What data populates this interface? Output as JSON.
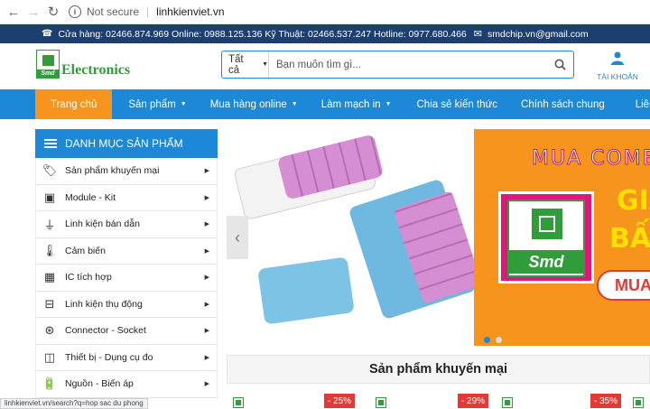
{
  "browser": {
    "security_label": "Not secure",
    "url": "linhkienviet.vn"
  },
  "topbar": {
    "contact_text": "Cửa hàng: 02466.874.969 Online: 0988.125.136 Kỹ Thuật: 02466.537.247 Hotline: 0977.680.466",
    "email": "smdchip.vn@gmail.com"
  },
  "header": {
    "logo_badge": "Smd",
    "logo_text": "Electronics",
    "search_category": "Tất cả",
    "search_placeholder": "Bạn muốn tìm gì...",
    "account_label": "TÀI KHOẢN"
  },
  "mainnav": {
    "items": [
      {
        "label": "Trang chủ",
        "active": true,
        "dropdown": false
      },
      {
        "label": "Sản phẩm",
        "active": false,
        "dropdown": true
      },
      {
        "label": "Mua hàng online",
        "active": false,
        "dropdown": true
      },
      {
        "label": "Làm mạch in",
        "active": false,
        "dropdown": true
      },
      {
        "label": "Chia sẻ kiến thức",
        "active": false,
        "dropdown": false
      },
      {
        "label": "Chính sách chung",
        "active": false,
        "dropdown": false
      },
      {
        "label": "Liên hệ",
        "active": false,
        "dropdown": false
      }
    ]
  },
  "sidebar": {
    "title": "DANH MỤC SẢN PHẨM",
    "items": [
      {
        "label": "Sản phẩm khuyến mại",
        "icon": "tag-icon"
      },
      {
        "label": "Module - Kit",
        "icon": "module-icon"
      },
      {
        "label": "Linh kiện bán dẫn",
        "icon": "transistor-icon"
      },
      {
        "label": "Cảm biến",
        "icon": "thermometer-icon"
      },
      {
        "label": "IC tích hợp",
        "icon": "chip-icon"
      },
      {
        "label": "Linh kiện thụ động",
        "icon": "capacitor-icon"
      },
      {
        "label": "Connector - Socket",
        "icon": "connector-icon"
      },
      {
        "label": "Thiết bị - Dụng cụ đo",
        "icon": "meter-icon"
      },
      {
        "label": "Nguồn - Biến áp",
        "icon": "car-battery-icon"
      }
    ]
  },
  "banner": {
    "headline": "MUA COMBO",
    "line1": "GIÁ",
    "line2": "BẤT",
    "cta": "MUA",
    "logo_badge": "Smd",
    "active_slide": 1,
    "slide_count": 2
  },
  "promo": {
    "title": "Sản phẩm khuyến mại",
    "discounts": [
      "- 25%",
      "- 29%",
      "- 35%"
    ]
  },
  "status_bar": {
    "url": "linhkienviet.vn/search?q=hop sac du phong"
  },
  "colors": {
    "primary_blue": "#1e88d8",
    "topbar_navy": "#1d3f70",
    "active_orange": "#f7941d",
    "brand_green": "#2f9e3a",
    "discount_red": "#e53935"
  }
}
